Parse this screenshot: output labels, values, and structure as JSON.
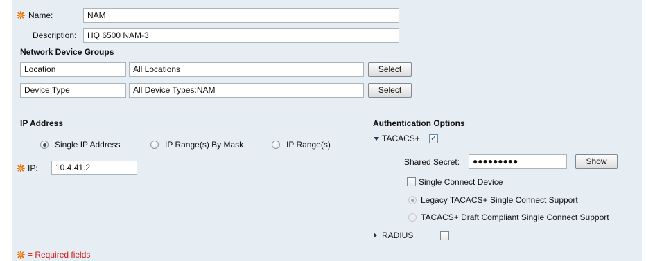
{
  "form": {
    "name": {
      "label": "Name:",
      "value": "NAM"
    },
    "description": {
      "label": "Description:",
      "value": "HQ 6500 NAM-3"
    }
  },
  "ndg": {
    "heading": "Network Device Groups",
    "rows": [
      {
        "name": "Location",
        "value": "All Locations",
        "button": "Select"
      },
      {
        "name": "Device Type",
        "value": "All Device Types:NAM",
        "button": "Select"
      }
    ]
  },
  "ip": {
    "heading": "IP Address",
    "options": [
      {
        "label": "Single IP Address",
        "selected": true
      },
      {
        "label": "IP Range(s) By Mask",
        "selected": false
      },
      {
        "label": "IP Range(s)",
        "selected": false
      }
    ],
    "ip_label": "IP:",
    "ip_value": "10.4.41.2"
  },
  "auth": {
    "heading": "Authentication Options",
    "tacacs": {
      "label": "TACACS+",
      "checked": true,
      "expanded": true
    },
    "shared_secret": {
      "label": "Shared Secret:",
      "masked": "●●●●●●●●●",
      "show_button": "Show"
    },
    "single_connect": {
      "label": "Single Connect Device",
      "checked": false
    },
    "legacy": {
      "label": "Legacy TACACS+ Single Connect Support",
      "selected": true
    },
    "draft": {
      "label": "TACACS+ Draft Compliant Single Connect Support",
      "selected": false
    },
    "radius": {
      "label": "RADIUS",
      "checked": false,
      "expanded": false
    }
  },
  "footer": {
    "required_note": "= Required fields"
  },
  "colors": {
    "required": "#e8731a",
    "required_text": "#d21a1a",
    "panel_bg": "#e7eef3"
  }
}
